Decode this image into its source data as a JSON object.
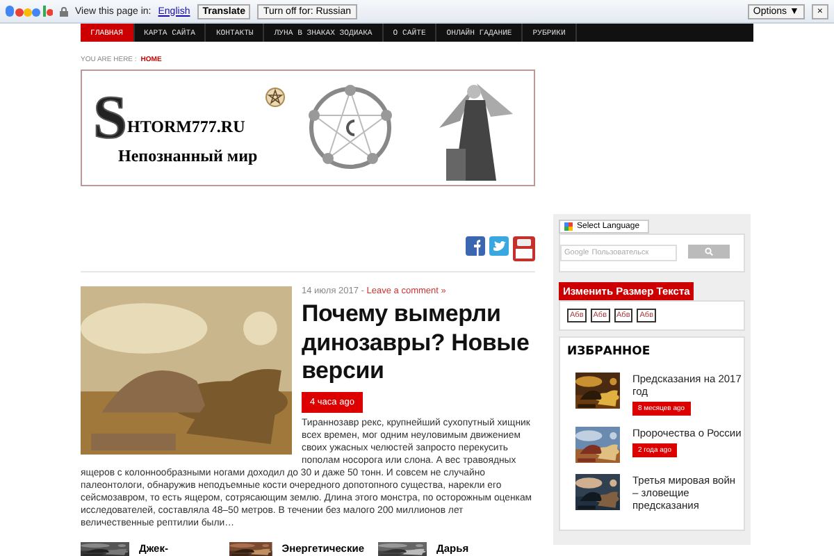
{
  "translate_bar": {
    "view_label": "View this page in:",
    "language": "English",
    "translate_button": "Translate",
    "turn_off_button": "Turn off for: Russian",
    "options_button": "Options ▼",
    "close": "×"
  },
  "nav": [
    {
      "label": "ГЛАВНАЯ",
      "selected": true
    },
    {
      "label": "КАРТА САЙТА",
      "selected": false
    },
    {
      "label": "КОНТАКТЫ",
      "selected": false
    },
    {
      "label": "ЛУНА В ЗНАКАХ ЗОДИАКА",
      "selected": false
    },
    {
      "label": "О САЙТЕ",
      "selected": false
    },
    {
      "label": "ОНЛАЙН ГАДАНИЕ",
      "selected": false
    },
    {
      "label": "РУБРИКИ",
      "selected": false
    }
  ],
  "breadcrumb": {
    "label": "YOU ARE HERE :",
    "current": "HOME"
  },
  "banner": {
    "logo_initial": "S",
    "logo_text": "HTORM777.RU",
    "tagline": "Непознанный мир"
  },
  "post": {
    "date": "14 июля 2017 - ",
    "comment_link": "Leave a comment »",
    "title": "Почему вымерли динозавры? Новые версии",
    "badge": "4 часа ago",
    "excerpt": "Тираннозавр рекс, крупнейший сухопутный хищник всех времен, мог одним неуловимым движением своих ужасных челюстей запросто перекусить пополам носорога или слона. А вес травоядных ящеров с колоннообразными ногами доходил до 30 и даже 50 тонн. И совсем не случайно палеонтологи, обнаружив неподъемные кости очередного допотопного существа, нарекли его сейсмозавром, то есть ящером, сотрясающим землю. Длина этого монстра, по осторожным оценкам исследователей, составляла 48–50 метров. В течении без малого 200 миллионов лет величественные рептилии были…"
  },
  "related": [
    {
      "title": "Джек-"
    },
    {
      "title": "Энергетические"
    },
    {
      "title": "Дарья"
    }
  ],
  "sidebar": {
    "language_select": "Select Language",
    "search_brand": "Google",
    "search_placeholder": "Пользовательск",
    "text_size_title": "Изменить Размер Текста",
    "text_size_buttons": [
      "Абв",
      "Абв",
      "Абв",
      "Абв"
    ],
    "favorites_title": "ИЗБРАННОЕ",
    "favorites": [
      {
        "title": "Предсказания на 2017 год",
        "badge": "8 месяцев ago"
      },
      {
        "title": "Пророчества о России",
        "badge": "2 года ago"
      },
      {
        "title": "Третья мировая войн – зловещие предсказания"
      }
    ]
  }
}
